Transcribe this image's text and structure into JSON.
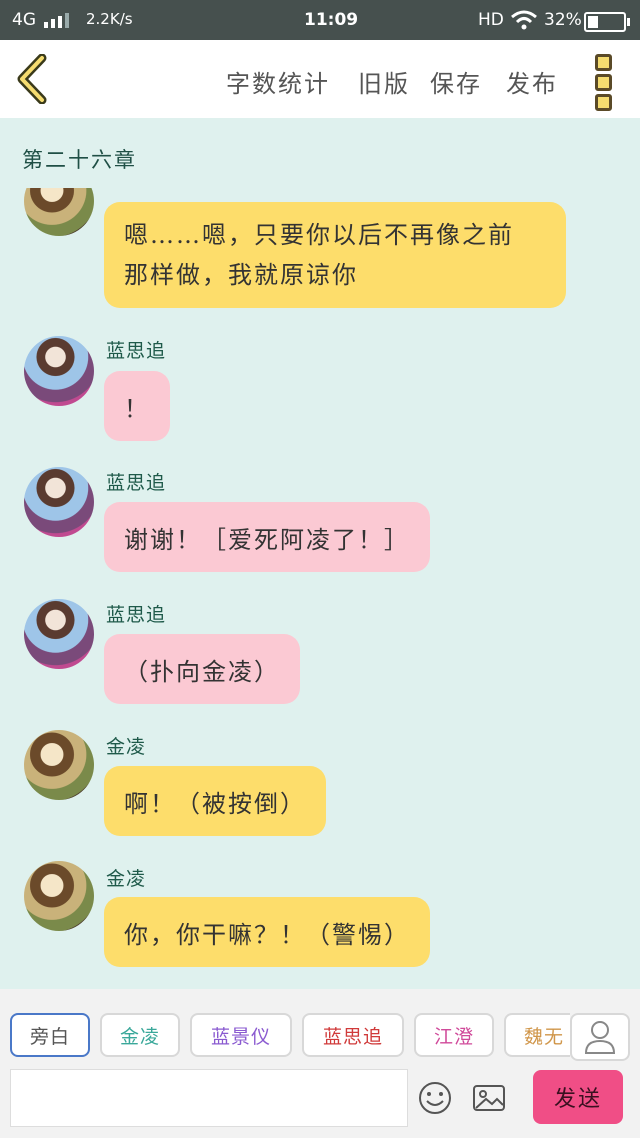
{
  "status_bar": {
    "network": "4G",
    "speed": "2.2K/s",
    "time": "11:09",
    "hd": "HD",
    "battery_text": "32%",
    "battery_level": 0.32
  },
  "header": {
    "word_count_label": "字数统计",
    "old_version_label": "旧版",
    "save_label": "保存",
    "publish_label": "发布"
  },
  "chapter_title": "第二十六章",
  "messages": [
    {
      "speaker": "",
      "text_line1": "嗯……嗯，只要你以后不再像之前",
      "text_line2": "那样做，我就原谅你"
    },
    {
      "speaker": "蓝思追",
      "text": "！"
    },
    {
      "speaker": "蓝思追",
      "text": "谢谢！［爱死阿凌了！］"
    },
    {
      "speaker": "蓝思追",
      "text": "（扑向金凌）"
    },
    {
      "speaker": "金凌",
      "text": "啊！（被按倒）"
    },
    {
      "speaker": "金凌",
      "text": "你，你干嘛？！（警惕）"
    }
  ],
  "characters": [
    {
      "label": "旁白",
      "color": "#555555"
    },
    {
      "label": "金凌",
      "color": "#3aa89a"
    },
    {
      "label": "蓝景仪",
      "color": "#8a5ad0"
    },
    {
      "label": "蓝思追",
      "color": "#d03a3a"
    },
    {
      "label": "江澄",
      "color": "#d04a9a"
    },
    {
      "label": "魏无",
      "color": "#d0964a"
    }
  ],
  "input": {
    "placeholder": ""
  },
  "send_label": "发送",
  "colors": {
    "chat_bg": "#dff1ee",
    "bubble_yellow": "#fddd6b",
    "bubble_pink": "#fbc9d3",
    "send": "#f04e86"
  },
  "icons": [
    "back-icon",
    "more-icon",
    "user-icon",
    "emoji-icon",
    "image-icon",
    "wifi-icon",
    "signal-icon",
    "battery-icon"
  ]
}
